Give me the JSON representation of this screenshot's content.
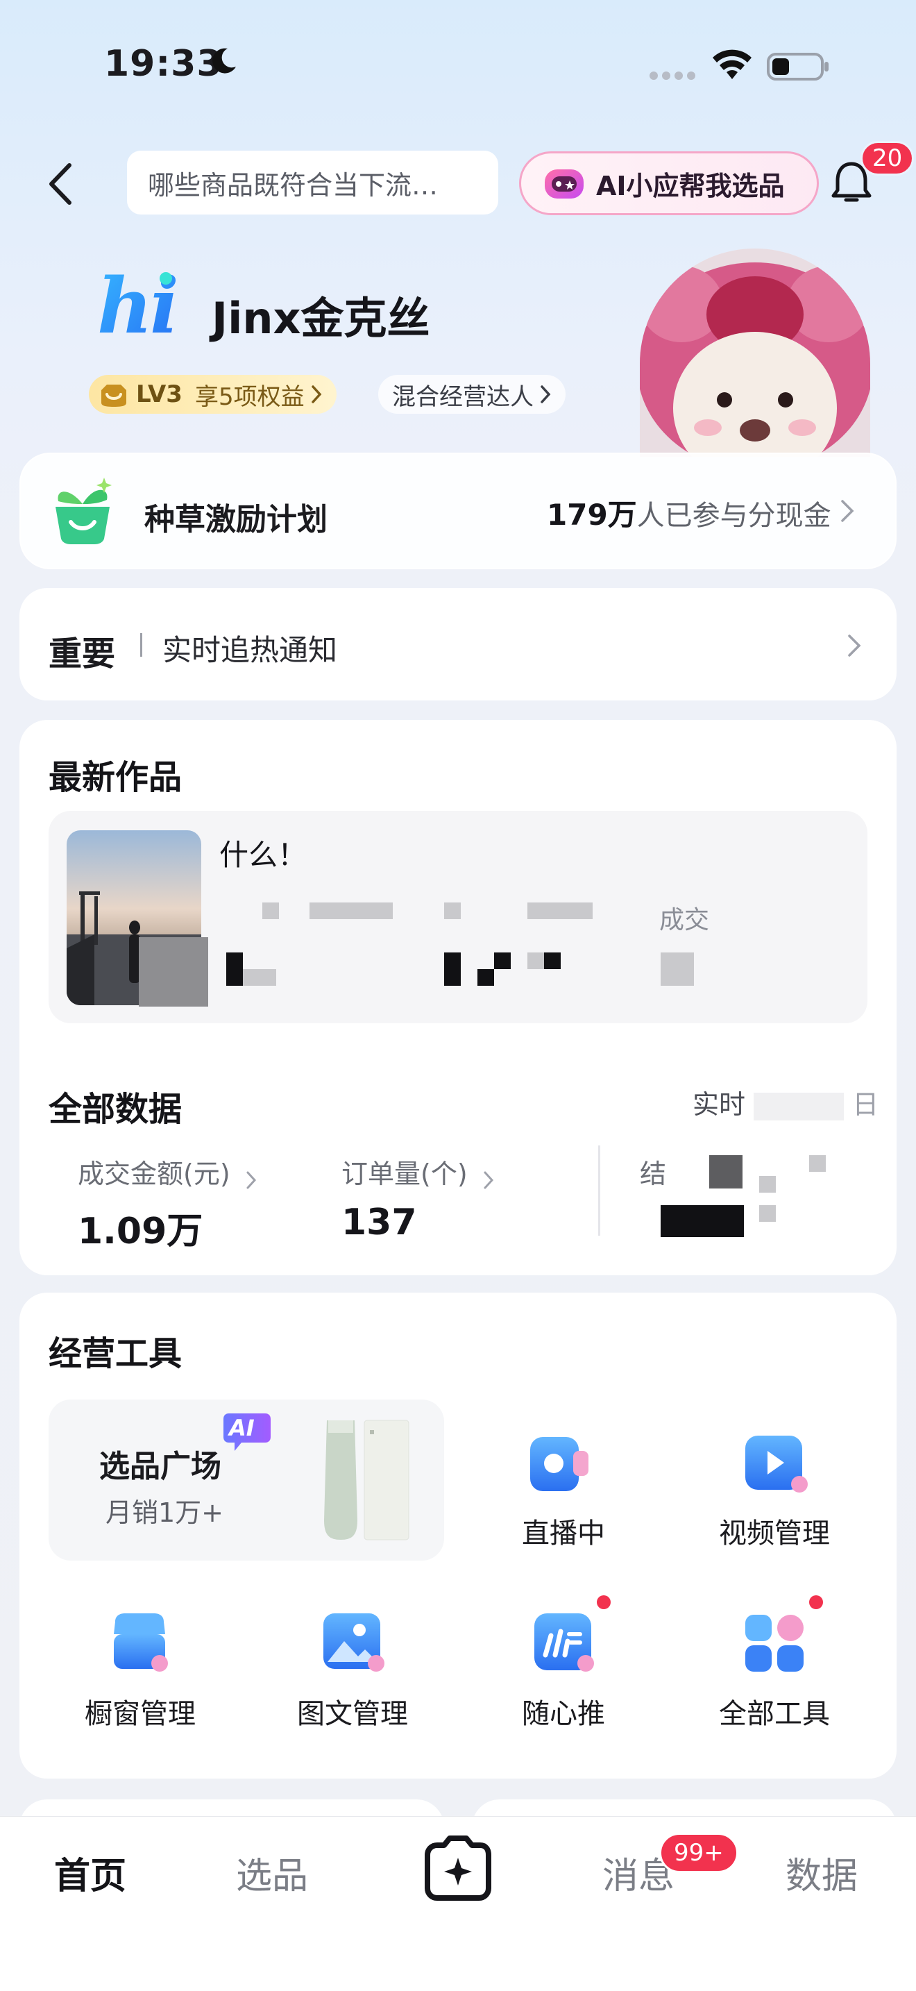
{
  "status_bar": {
    "time": "19:33"
  },
  "header": {
    "search_placeholder": "哪些商品既符合当下流…",
    "ai_button_label": "AI小应帮我选品",
    "notification_count": "20"
  },
  "profile": {
    "logo": "hi",
    "username": "Jinx金克丝",
    "level": "LV3",
    "level_benefit": "享5项权益",
    "role": "混合经营达人"
  },
  "incentive": {
    "title": "种草激励计划",
    "count": "179万",
    "suffix": "人已参与分现金"
  },
  "notice": {
    "title": "重要",
    "subtitle": "实时追热通知"
  },
  "latest_works": {
    "title": "最新作品",
    "item_title": "什么！",
    "partial_label": "成交"
  },
  "all_data": {
    "title": "全部数据",
    "period": "实时",
    "period_suffix": "日",
    "metrics": [
      {
        "label": "成交金额(元)",
        "value": "1.09万"
      },
      {
        "label": "订单量(个)",
        "value": "137"
      },
      {
        "label": "结"
      }
    ]
  },
  "tools": {
    "title": "经营工具",
    "feature": {
      "title": "选品广场",
      "subtitle": "月销1万+",
      "tag": "AI"
    },
    "items": [
      {
        "label": "直播中",
        "icon": "live-icon"
      },
      {
        "label": "视频管理",
        "icon": "video-icon"
      },
      {
        "label": "橱窗管理",
        "icon": "window-icon"
      },
      {
        "label": "图文管理",
        "icon": "image-text-icon"
      },
      {
        "label": "随心推",
        "icon": "promote-icon"
      },
      {
        "label": "全部工具",
        "icon": "all-tools-icon"
      }
    ]
  },
  "tabbar": {
    "tabs": [
      "首页",
      "选品",
      "消息",
      "数据"
    ],
    "message_badge": "99+",
    "active": "首页"
  },
  "colors": {
    "accent_red": "#f2324e",
    "text_primary": "#141418"
  }
}
